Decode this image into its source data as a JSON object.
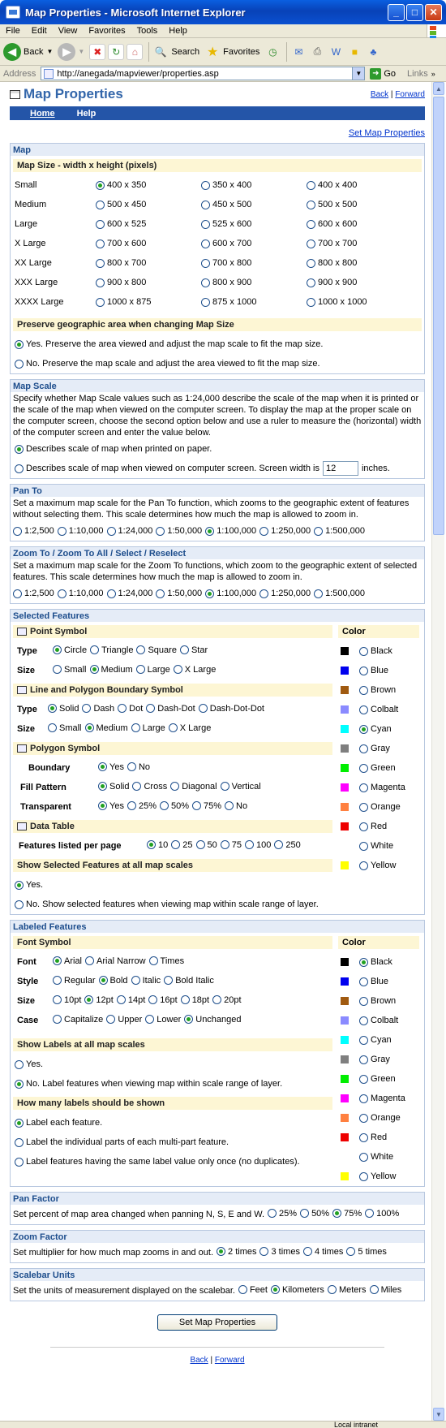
{
  "window": {
    "title": "Map Properties - Microsoft Internet Explorer",
    "min": "_",
    "max": "□",
    "close": "✕"
  },
  "menu": [
    "File",
    "Edit",
    "View",
    "Favorites",
    "Tools",
    "Help"
  ],
  "toolbar": {
    "back": "Back",
    "search": "Search",
    "favorites": "Favorites"
  },
  "address": {
    "label": "Address",
    "url": "http://anegada/mapviewer/properties.asp",
    "go": "Go",
    "links": "Links"
  },
  "status": {
    "zone": "Local intranet"
  },
  "page": {
    "title": "Map Properties",
    "back": "Back",
    "forward": "Forward",
    "sep": "|",
    "nav": [
      "Home",
      "Help"
    ],
    "set_link": "Set Map Properties",
    "button": "Set Map Properties"
  },
  "map": {
    "title": "Map",
    "size_head": "Map Size - width x height (pixels)",
    "sizes": [
      {
        "label": "Small",
        "opts": [
          "400 x 350",
          "350 x 400",
          "400 x 400"
        ],
        "sel": 0
      },
      {
        "label": "Medium",
        "opts": [
          "500 x 450",
          "450 x 500",
          "500 x 500"
        ],
        "sel": -1
      },
      {
        "label": "Large",
        "opts": [
          "600 x 525",
          "525 x 600",
          "600 x 600"
        ],
        "sel": -1
      },
      {
        "label": "X Large",
        "opts": [
          "700 x 600",
          "600 x 700",
          "700 x 700"
        ],
        "sel": -1
      },
      {
        "label": "XX Large",
        "opts": [
          "800 x 700",
          "700 x 800",
          "800 x 800"
        ],
        "sel": -1
      },
      {
        "label": "XXX Large",
        "opts": [
          "900 x 800",
          "800 x 900",
          "900 x 900"
        ],
        "sel": -1
      },
      {
        "label": "XXXX Large",
        "opts": [
          "1000 x 875",
          "875 x 1000",
          "1000 x 1000"
        ],
        "sel": -1
      }
    ],
    "preserve_head": "Preserve geographic area when changing Map Size",
    "preserve_yes": "Yes. Preserve the area viewed and adjust the map scale to fit the map size.",
    "preserve_no": "No. Preserve the map scale and adjust the area viewed to fit the map size."
  },
  "scale": {
    "title": "Map Scale",
    "desc": "Specify whether Map Scale values such as 1:24,000 describe the scale of the map when it is printed or the scale of the map when viewed on the computer screen. To display the map at the proper scale on the computer screen, choose the second option below and use a ruler to measure the (horizontal) width of the computer screen and enter the value below.",
    "opt1": "Describes scale of map when printed on paper.",
    "opt2": "Describes scale of map when viewed on computer screen. Screen width is",
    "width": "12",
    "unit": "inches."
  },
  "panto": {
    "title": "Pan To",
    "desc": "Set a maximum map scale for the Pan To function, which zooms to the geographic extent of features without selecting them. This scale determines how much the map is allowed to zoom in.",
    "opts": [
      "1:2,500",
      "1:10,000",
      "1:24,000",
      "1:50,000",
      "1:100,000",
      "1:250,000",
      "1:500,000"
    ],
    "sel": 4
  },
  "zoomto": {
    "title": "Zoom To / Zoom To All / Select / Reselect",
    "desc": "Set a maximum map scale for the Zoom To functions, which zoom to the geographic extent of selected features. This scale determines how much the map is allowed to zoom in.",
    "opts": [
      "1:2,500",
      "1:10,000",
      "1:24,000",
      "1:50,000",
      "1:100,000",
      "1:250,000",
      "1:500,000"
    ],
    "sel": 4
  },
  "selected": {
    "title": "Selected Features",
    "color_head": "Color",
    "point_head": "Point Symbol",
    "type": "Type",
    "size": "Size",
    "point_types": [
      "Circle",
      "Triangle",
      "Square",
      "Star"
    ],
    "point_sizes": [
      "Small",
      "Medium",
      "Large",
      "X Large"
    ],
    "line_head": "Line and Polygon Boundary Symbol",
    "line_types": [
      "Solid",
      "Dash",
      "Dot",
      "Dash-Dot",
      "Dash-Dot-Dot"
    ],
    "line_sizes": [
      "Small",
      "Medium",
      "Large",
      "X Large"
    ],
    "poly_head": "Polygon Symbol",
    "boundary": "Boundary",
    "fill": "Fill Pattern",
    "transparent": "Transparent",
    "boundary_opts": [
      "Yes",
      "No"
    ],
    "fill_opts": [
      "Solid",
      "Cross",
      "Diagonal",
      "Vertical"
    ],
    "trans_opts": [
      "Yes",
      "25%",
      "50%",
      "75%",
      "No"
    ],
    "table_head": "Data Table",
    "per_page": "Features listed per page",
    "per_page_opts": [
      "10",
      "25",
      "50",
      "75",
      "100",
      "250"
    ],
    "show_head": "Show Selected Features at all map scales",
    "show_yes": "Yes.",
    "show_no": "No. Show selected features when viewing map within scale range of layer.",
    "color_sel": 4
  },
  "colors": [
    {
      "name": "Black",
      "hex": "#000000"
    },
    {
      "name": "Blue",
      "hex": "#0000ee"
    },
    {
      "name": "Brown",
      "hex": "#a05a10"
    },
    {
      "name": "Colbalt",
      "hex": "#8a8aff"
    },
    {
      "name": "Cyan",
      "hex": "#00ffff"
    },
    {
      "name": "Gray",
      "hex": "#7f7f7f"
    },
    {
      "name": "Green",
      "hex": "#00ee00"
    },
    {
      "name": "Magenta",
      "hex": "#ff00ff"
    },
    {
      "name": "Orange",
      "hex": "#ff8040"
    },
    {
      "name": "Red",
      "hex": "#ee0000"
    },
    {
      "name": "White",
      "hex": "#ffffff"
    },
    {
      "name": "Yellow",
      "hex": "#ffff00"
    }
  ],
  "labeled": {
    "title": "Labeled Features",
    "font_head": "Font Symbol",
    "color_head": "Color",
    "font": "Font",
    "style": "Style",
    "size": "Size",
    "case": "Case",
    "fonts": [
      "Arial",
      "Arial Narrow",
      "Times"
    ],
    "styles": [
      "Regular",
      "Bold",
      "Italic",
      "Bold Italic"
    ],
    "sizes": [
      "10pt",
      "12pt",
      "14pt",
      "16pt",
      "18pt",
      "20pt"
    ],
    "cases": [
      "Capitalize",
      "Upper",
      "Lower",
      "Unchanged"
    ],
    "show_head": "Show Labels at all map scales",
    "show_yes": "Yes.",
    "show_no": "No. Label features when viewing map within scale range of layer.",
    "many_head": "How many labels should be shown",
    "many1": "Label each feature.",
    "many2": "Label the individual parts of each multi-part feature.",
    "many3": "Label features having the same label value only once (no duplicates).",
    "color_sel": 0
  },
  "panfactor": {
    "title": "Pan Factor",
    "desc": "Set percent of map area changed when panning N, S, E and W.",
    "opts": [
      "25%",
      "50%",
      "75%",
      "100%"
    ],
    "sel": 2
  },
  "zoomfactor": {
    "title": "Zoom Factor",
    "desc": "Set multiplier for how much map zooms in and out.",
    "opts": [
      "2 times",
      "3 times",
      "4 times",
      "5 times"
    ],
    "sel": 0
  },
  "scalebar": {
    "title": "Scalebar Units",
    "desc": "Set the units of measurement displayed on the scalebar.",
    "opts": [
      "Feet",
      "Kilometers",
      "Meters",
      "Miles"
    ],
    "sel": 1
  }
}
